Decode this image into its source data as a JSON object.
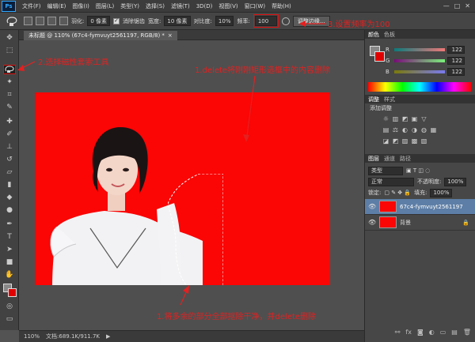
{
  "menubar": {
    "logo": "Ps",
    "items": [
      "文件(F)",
      "编辑(E)",
      "图像(I)",
      "图层(L)",
      "类型(Y)",
      "选择(S)",
      "滤镜(T)",
      "3D(D)",
      "视图(V)",
      "窗口(W)",
      "帮助(H)"
    ],
    "window_controls": [
      "—",
      "□",
      "✕"
    ]
  },
  "optbar": {
    "feather_label": "羽化:",
    "feather_value": "0 像素",
    "antialias_label": "消除锯齿",
    "width_label": "宽度:",
    "width_value": "10 像素",
    "contrast_label": "对比度:",
    "contrast_value": "10%",
    "frequency_label": "频率:",
    "frequency_value": "100",
    "refine_edge_label": "调整边缘..."
  },
  "document": {
    "tab_title": "未标题 @ 110% (67c4-fymvuyt2561197, RGB/8) *",
    "tab_close": "×"
  },
  "status": {
    "zoom": "110%",
    "doc_info": "文档:689.1K/911.7K"
  },
  "color_panel": {
    "tabs": [
      "颜色",
      "色板"
    ],
    "channels": [
      {
        "letter": "R",
        "value": "122"
      },
      {
        "letter": "G",
        "value": "122"
      },
      {
        "letter": "B",
        "value": "122"
      }
    ]
  },
  "adjust_panel": {
    "tabs": [
      "调整",
      "样式"
    ],
    "title": "添加调整",
    "row1_icons": [
      "☼",
      "▥",
      "◩",
      "▣",
      "▽"
    ],
    "row2_icons": [
      "▤",
      "⚖",
      "◐",
      "◑",
      "◍",
      "▦"
    ],
    "row3_icons": [
      "◪",
      "◩",
      "▨",
      "▩",
      "▧"
    ]
  },
  "layers_panel": {
    "tabs": [
      "图层",
      "通道",
      "路径"
    ],
    "kind_label": "类型",
    "blend_mode": "正常",
    "opacity_label": "不透明度:",
    "opacity_value": "100%",
    "lock_label": "锁定:",
    "fill_label": "填充:",
    "fill_value": "100%",
    "layers": [
      {
        "name": "67c4-fymvuyt2561197",
        "selected": true
      },
      {
        "name": "背景",
        "selected": false
      }
    ],
    "footer_icons": [
      "⚯",
      "fx",
      "◙",
      "◐",
      "▭",
      "▤",
      "🗑"
    ]
  },
  "annotations": {
    "step1_top": "1.delete将刚刚矩形选框中的内容删除",
    "step1_bottom": "1.将多余的部分全部抠除干净，并delete删除",
    "step2": "2.选择磁性套索工具",
    "step3": "3.设置频率为100"
  },
  "colors": {
    "canvas_red": "#fb0505",
    "annotation_red": "#e42020",
    "selected_layer": "#5d7ea6"
  }
}
